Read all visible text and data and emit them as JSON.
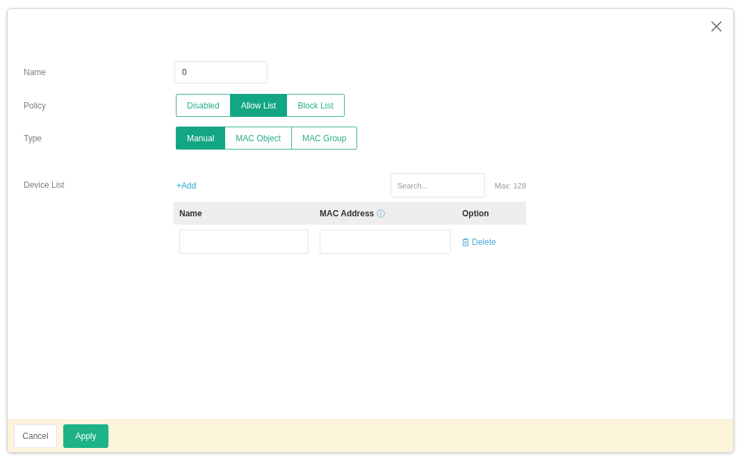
{
  "form": {
    "name": {
      "label": "Name",
      "value": "0"
    },
    "policy": {
      "label": "Policy",
      "options": [
        {
          "label": "Disabled",
          "selected": false
        },
        {
          "label": "Allow List",
          "selected": true
        },
        {
          "label": "Block List",
          "selected": false
        }
      ]
    },
    "type": {
      "label": "Type",
      "options": [
        {
          "label": "Manual",
          "selected": true
        },
        {
          "label": "MAC Object",
          "selected": false
        },
        {
          "label": "MAC Group",
          "selected": false
        }
      ]
    },
    "device_list": {
      "label": "Device List",
      "add": "+Add",
      "search": {
        "placeholder": "Search..."
      },
      "max": "Max: 128",
      "table": {
        "columns": [
          {
            "label": "Name",
            "info": false
          },
          {
            "label": "MAC Address",
            "info": true
          },
          {
            "label": "Option",
            "info": false
          }
        ],
        "rows": [
          {
            "action": "Delete"
          }
        ]
      }
    }
  },
  "footer": {
    "buttons": [
      {
        "label": "Cancel",
        "kind": "secondary"
      },
      {
        "label": "Apply",
        "kind": "primary"
      }
    ]
  }
}
